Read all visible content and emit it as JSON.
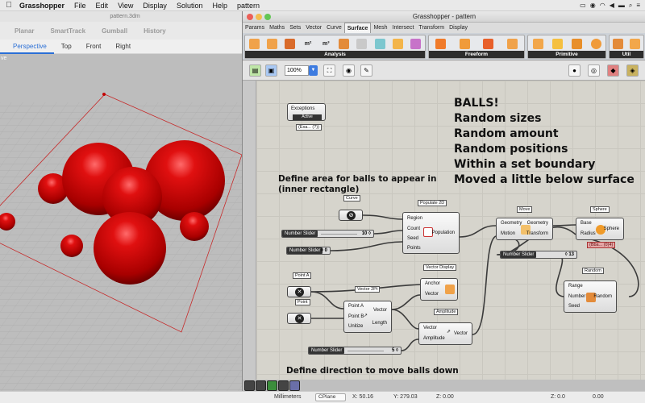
{
  "menubar": {
    "app_name": "Grasshopper",
    "items": [
      "File",
      "Edit",
      "View",
      "Display",
      "Solution",
      "Help",
      "pattern"
    ],
    "clock_icons": [
      "screen-icon",
      "wifi-icon",
      "volume-icon",
      "battery-icon"
    ]
  },
  "rhino": {
    "doc_title": "pattern.3dm",
    "toolbar_tabs": [
      "Planar",
      "SmartTrack",
      "Gumball",
      "History"
    ],
    "view_tabs": [
      "Perspective",
      "Top",
      "Front",
      "Right"
    ],
    "active_view": "Perspective",
    "viewport_label": "ve",
    "status": {
      "units": "Millimeters",
      "cplane": "CPlane",
      "x": "X: 50.16",
      "y": "Y: 279.03",
      "z": "Z: 0.00",
      "extra_z": "Z: 0.0",
      "extra_y": "0.00"
    }
  },
  "grasshopper": {
    "title": "Grasshopper - pattern",
    "tabs": [
      "Params",
      "Maths",
      "Sets",
      "Vector",
      "Curve",
      "Surface",
      "Mesh",
      "Intersect",
      "Transform",
      "Display"
    ],
    "active_tab": "Surface",
    "ribbon_groups": [
      "Analysis",
      "Freeform",
      "Primitive",
      "Util"
    ],
    "zoom": "100%",
    "notes": {
      "title_lines": [
        "BALLS!",
        "Random sizes",
        "Random amount",
        "Random positions",
        "Within a set boundary",
        "Moved a little below surface"
      ],
      "area_note": "Define area for balls to appear in (inner rectangle)",
      "direction_note": "Define direction to move balls down"
    },
    "components": {
      "exceptions": {
        "label": "Exceptions",
        "state": "Active",
        "tag": "(Exa... (?))"
      },
      "curve": {
        "label": "Curve"
      },
      "populate": {
        "label": "Populate 2D",
        "inputs": [
          "Region",
          "Count",
          "Seed",
          "Points"
        ],
        "output": "Population"
      },
      "move": {
        "label": "Move",
        "inputs": [
          "Geometry",
          "Motion"
        ],
        "outputs": [
          "Geometry",
          "Transform"
        ]
      },
      "sphere": {
        "label": "Sphere",
        "inputs": [
          "Base",
          "Radius"
        ],
        "output": "Sphere",
        "warning": "(Bba... (0)4)"
      },
      "random": {
        "label": "Random",
        "inputs": [
          "Range",
          "Number",
          "Seed"
        ],
        "output": "Random"
      },
      "point_a": {
        "label": "Point A"
      },
      "point": {
        "label": "Point"
      },
      "vector2pt": {
        "label": "Vector 2Pt",
        "inputs": [
          "Point A",
          "Point B",
          "Unitize"
        ],
        "outputs": [
          "Vector",
          "Length"
        ]
      },
      "vector_display": {
        "label": "Vector Display",
        "inputs": [
          "Anchor",
          "Vector"
        ]
      },
      "amplitude": {
        "label": "Amplitude",
        "inputs": [
          "Vector",
          "Amplitude"
        ],
        "output": "Vector"
      }
    },
    "sliders": [
      {
        "label": "Number Slider",
        "value": "10 ◊"
      },
      {
        "label": "Number Slider",
        "value": "◊ 0"
      },
      {
        "label": "Number Slider",
        "value": "◊ 13"
      },
      {
        "label": "Number Slider",
        "value": "5 ◊"
      }
    ]
  },
  "colors": {
    "ball": "#c40000",
    "canvas": "#d6d4cc",
    "accent": "#2a6fd6"
  }
}
